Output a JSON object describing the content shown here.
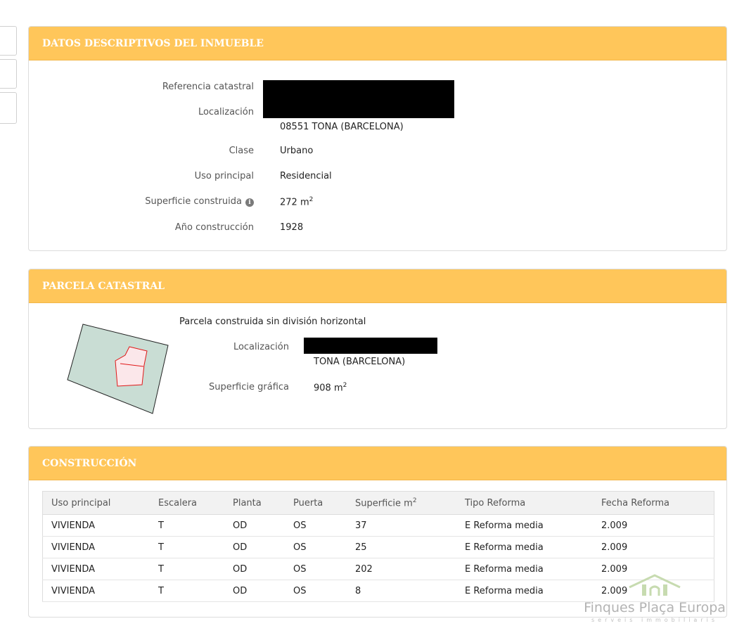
{
  "descriptivos": {
    "title": "DATOS DESCRIPTIVOS DEL INMUEBLE",
    "ref_label": "Referencia catastral",
    "loc_label": "Localización",
    "loc_value": "08551 TONA (BARCELONA)",
    "clase_label": "Clase",
    "clase_value": "Urbano",
    "uso_label": "Uso principal",
    "uso_value": "Residencial",
    "sup_label": "Superficie construida",
    "sup_value": "272 m",
    "sup_unit_sup": "2",
    "anio_label": "Año construcción",
    "anio_value": "1928"
  },
  "parcela": {
    "title": "PARCELA CATASTRAL",
    "heading": "Parcela construida sin división horizontal",
    "loc_label": "Localización",
    "loc_value": "TONA (BARCELONA)",
    "sup_label": "Superficie gráfica",
    "sup_value": "908 m",
    "sup_unit_sup": "2"
  },
  "construccion": {
    "title": "CONSTRUCCIÓN",
    "columns": [
      "Uso principal",
      "Escalera",
      "Planta",
      "Puerta",
      "Superficie m",
      "Tipo Reforma",
      "Fecha Reforma"
    ],
    "sup_col_sup": "2",
    "rows": [
      [
        "VIVIENDA",
        "T",
        "OD",
        "OS",
        "37",
        "E Reforma media",
        "2.009"
      ],
      [
        "VIVIENDA",
        "T",
        "OD",
        "OS",
        "25",
        "E Reforma media",
        "2.009"
      ],
      [
        "VIVIENDA",
        "T",
        "OD",
        "OS",
        "202",
        "E Reforma media",
        "2.009"
      ],
      [
        "VIVIENDA",
        "T",
        "OD",
        "OS",
        "8",
        "E Reforma media",
        "2.009"
      ]
    ]
  },
  "watermark": {
    "name": "Finques Plaça Europa",
    "sub": "serveis immobiliaris"
  },
  "colors": {
    "header_bg": "#ffc65a",
    "parcel_fill": "#c9ddd4",
    "building_outline": "#e01818"
  }
}
